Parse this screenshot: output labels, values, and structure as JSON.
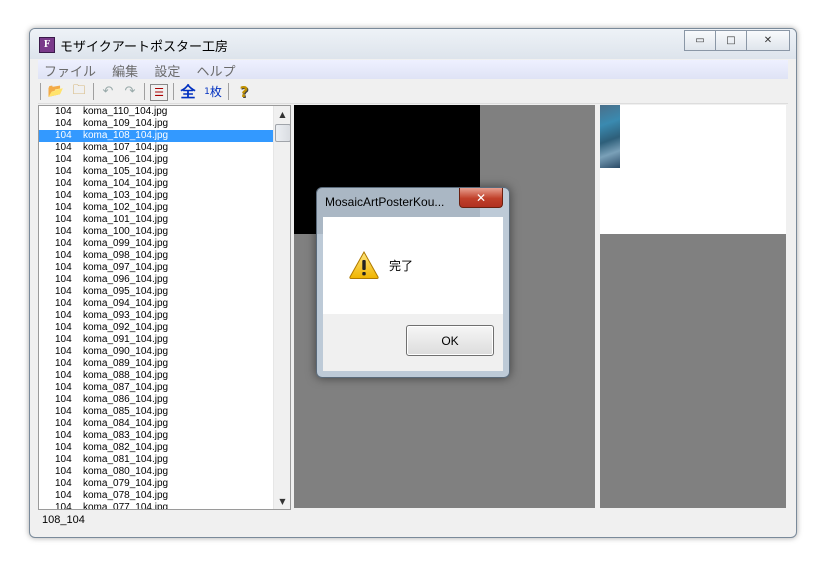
{
  "window": {
    "title": "モザイクアートポスター工房",
    "icon_label": "F",
    "caption": {
      "minimize": "▭",
      "maximize": "□",
      "close": "✕"
    }
  },
  "menu": [
    "ファイル",
    "編集",
    "設定",
    "ヘルプ"
  ],
  "toolbar": {
    "open_icon": "📂",
    "folder_icon": "🗀",
    "undo_icon": "↶",
    "redo_icon": "↷",
    "list_icon": "☰",
    "all_label": "全",
    "one_label_sup": "1",
    "one_label": "枚",
    "help_icon": "?"
  },
  "file_list": {
    "selected_index": 2,
    "items": [
      {
        "num": "104",
        "name": "koma_110_104.jpg"
      },
      {
        "num": "104",
        "name": "koma_109_104.jpg"
      },
      {
        "num": "104",
        "name": "koma_108_104.jpg"
      },
      {
        "num": "104",
        "name": "koma_107_104.jpg"
      },
      {
        "num": "104",
        "name": "koma_106_104.jpg"
      },
      {
        "num": "104",
        "name": "koma_105_104.jpg"
      },
      {
        "num": "104",
        "name": "koma_104_104.jpg"
      },
      {
        "num": "104",
        "name": "koma_103_104.jpg"
      },
      {
        "num": "104",
        "name": "koma_102_104.jpg"
      },
      {
        "num": "104",
        "name": "koma_101_104.jpg"
      },
      {
        "num": "104",
        "name": "koma_100_104.jpg"
      },
      {
        "num": "104",
        "name": "koma_099_104.jpg"
      },
      {
        "num": "104",
        "name": "koma_098_104.jpg"
      },
      {
        "num": "104",
        "name": "koma_097_104.jpg"
      },
      {
        "num": "104",
        "name": "koma_096_104.jpg"
      },
      {
        "num": "104",
        "name": "koma_095_104.jpg"
      },
      {
        "num": "104",
        "name": "koma_094_104.jpg"
      },
      {
        "num": "104",
        "name": "koma_093_104.jpg"
      },
      {
        "num": "104",
        "name": "koma_092_104.jpg"
      },
      {
        "num": "104",
        "name": "koma_091_104.jpg"
      },
      {
        "num": "104",
        "name": "koma_090_104.jpg"
      },
      {
        "num": "104",
        "name": "koma_089_104.jpg"
      },
      {
        "num": "104",
        "name": "koma_088_104.jpg"
      },
      {
        "num": "104",
        "name": "koma_087_104.jpg"
      },
      {
        "num": "104",
        "name": "koma_086_104.jpg"
      },
      {
        "num": "104",
        "name": "koma_085_104.jpg"
      },
      {
        "num": "104",
        "name": "koma_084_104.jpg"
      },
      {
        "num": "104",
        "name": "koma_083_104.jpg"
      },
      {
        "num": "104",
        "name": "koma_082_104.jpg"
      },
      {
        "num": "104",
        "name": "koma_081_104.jpg"
      },
      {
        "num": "104",
        "name": "koma_080_104.jpg"
      },
      {
        "num": "104",
        "name": "koma_079_104.jpg"
      },
      {
        "num": "104",
        "name": "koma_078_104.jpg"
      },
      {
        "num": "104",
        "name": "koma_077_104.jpg"
      }
    ]
  },
  "status": "108_104",
  "dialog": {
    "title": "MosaicArtPosterKou...",
    "message": "完了",
    "ok_label": "OK",
    "close_glyph": "✕"
  },
  "colors": {
    "selection": "#3399ff",
    "preview_bg": "#808080",
    "dialog_close": "#c0402a"
  }
}
